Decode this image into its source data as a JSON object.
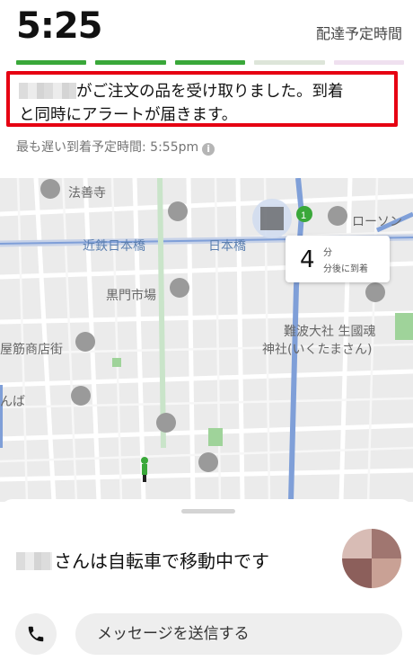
{
  "header": {
    "time": "5:25",
    "eta_label": "配達予定時間",
    "progress_segments": [
      "done",
      "done",
      "done",
      "todo",
      "pink"
    ]
  },
  "status": {
    "line1": "がご注文の品を受け取りました。到着",
    "line2": "と同時にアラートが届きます。"
  },
  "latest_arrival": "最も遅い到着予定時間: 5:55pm",
  "map": {
    "labels": {
      "temple": "法善寺",
      "station": "近鉄日本橋",
      "station2": "日本橋",
      "lawson": "ローソン",
      "market": "黒門市場",
      "shrine": "難波大社 生國魂神社(いくたまさん)",
      "shrine_line1": "難波大社 生國魂",
      "shrine_line2": "神社(いくたまさん)",
      "shotengai": "屋筋商店街",
      "namba": "んば"
    },
    "route_badge": "1",
    "eta_card": {
      "minutes": "4",
      "unit": "分",
      "sub": "分後に到着"
    }
  },
  "courier": {
    "status": "さんは自転車で移動中です"
  },
  "actions": {
    "message_label": "メッセージを送信する"
  },
  "colors": {
    "accent_red": "#e60012",
    "progress_green": "#3aa83a",
    "route_blue": "#7f9fd8"
  }
}
